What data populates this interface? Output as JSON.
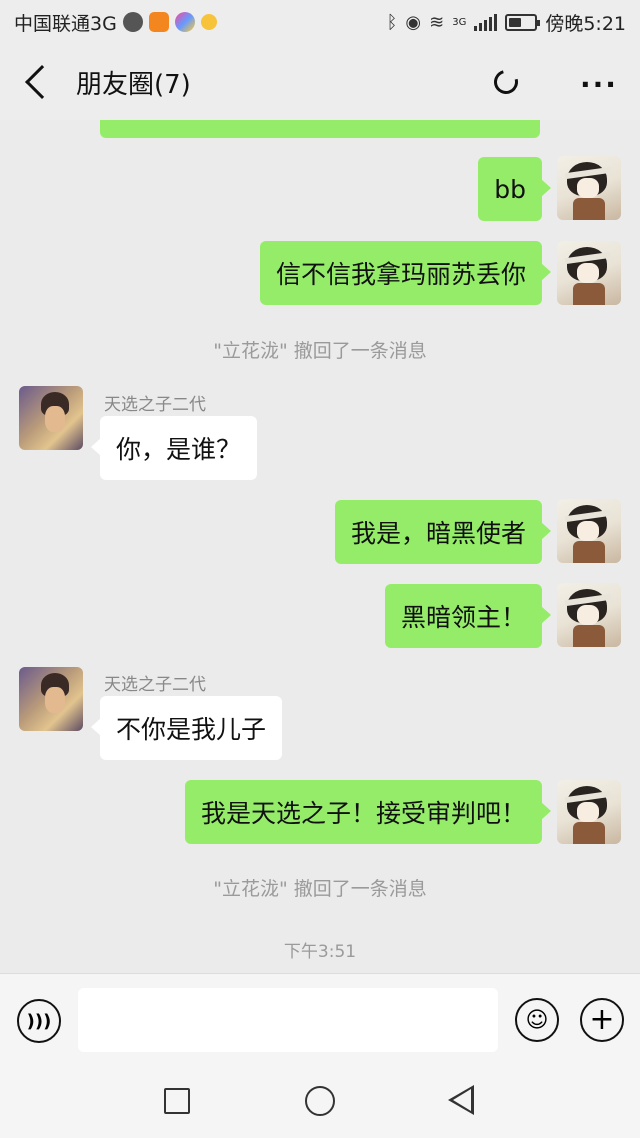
{
  "status_bar": {
    "carrier": "中国联通3G",
    "network_label": "3G",
    "time": "傍晚5:21",
    "battery_level": 0.5
  },
  "header": {
    "title": "朋友圈(7)"
  },
  "messages": [
    {
      "side": "me",
      "text": "bb"
    },
    {
      "side": "me",
      "text": "信不信我拿玛丽苏丢你"
    },
    {
      "type": "system",
      "text": "\"立花泷\" 撤回了一条消息"
    },
    {
      "side": "other",
      "sender": "天选之子二代",
      "text": "你，是谁？"
    },
    {
      "side": "me",
      "text": "我是，暗黑使者"
    },
    {
      "side": "me",
      "text": "黑暗领主！"
    },
    {
      "side": "other",
      "sender": "天选之子二代",
      "text": "不你是我儿子"
    },
    {
      "side": "me",
      "text": "我是天选之子！接受审判吧！"
    },
    {
      "type": "system",
      "text": "\"立花泷\" 撤回了一条消息"
    },
    {
      "type": "timestamp",
      "text": "下午3:51"
    }
  ],
  "input": {
    "value": "",
    "placeholder": ""
  },
  "icons": {
    "back": "back-arrow-icon",
    "refresh": "refresh-icon",
    "more": "more-icon",
    "voice": "voice-icon",
    "emoji": "emoji-icon",
    "plus": "plus-icon"
  },
  "colors": {
    "my_bubble": "#95ec69",
    "other_bubble": "#ffffff",
    "background": "#ebebeb"
  }
}
